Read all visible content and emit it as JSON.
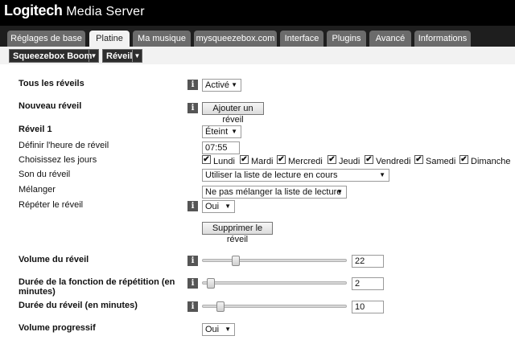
{
  "header": {
    "brand": "Logitech",
    "product": " Media Server"
  },
  "tabs": [
    {
      "label": "Réglages de base"
    },
    {
      "label": "Platine"
    },
    {
      "label": "Ma musique"
    },
    {
      "label": "mysqueezebox.com"
    },
    {
      "label": "Interface"
    },
    {
      "label": "Plugins"
    },
    {
      "label": "Avancé"
    },
    {
      "label": "Informations"
    }
  ],
  "subnav": {
    "player": "Squeezebox Boom",
    "section": "Réveil"
  },
  "settings": {
    "all_alarms": {
      "label": "Tous les réveils",
      "value": "Activé"
    },
    "new_alarm": {
      "label": "Nouveau réveil",
      "button": "Ajouter un réveil"
    },
    "alarm1": {
      "label": "Réveil 1",
      "state": "Éteint",
      "time_label": "Définir l'heure de réveil",
      "time": "07:55",
      "days_label": "Choisissez les jours",
      "days": [
        "Lundi",
        "Mardi",
        "Mercredi",
        "Jeudi",
        "Vendredi",
        "Samedi",
        "Dimanche"
      ],
      "days_checked": [
        true,
        true,
        true,
        true,
        true,
        true,
        true
      ],
      "sound_label": "Son du réveil",
      "sound": "Utiliser la liste de lecture en cours",
      "shuffle_label": "Mélanger",
      "shuffle": "Ne pas mélanger la liste de lecture",
      "repeat_label": "Répéter le réveil",
      "repeat": "Oui",
      "delete_button": "Supprimer le réveil"
    },
    "volume": {
      "label": "Volume du réveil",
      "value": "22"
    },
    "snooze": {
      "label": "Durée de la fonction de répétition (en minutes)",
      "value": "2"
    },
    "duration": {
      "label": "Durée du réveil (en minutes)",
      "value": "10"
    },
    "fade": {
      "label": "Volume progressif",
      "value": "Oui"
    }
  },
  "icons": {
    "info": "i",
    "caret": "▼",
    "check": "✔"
  }
}
